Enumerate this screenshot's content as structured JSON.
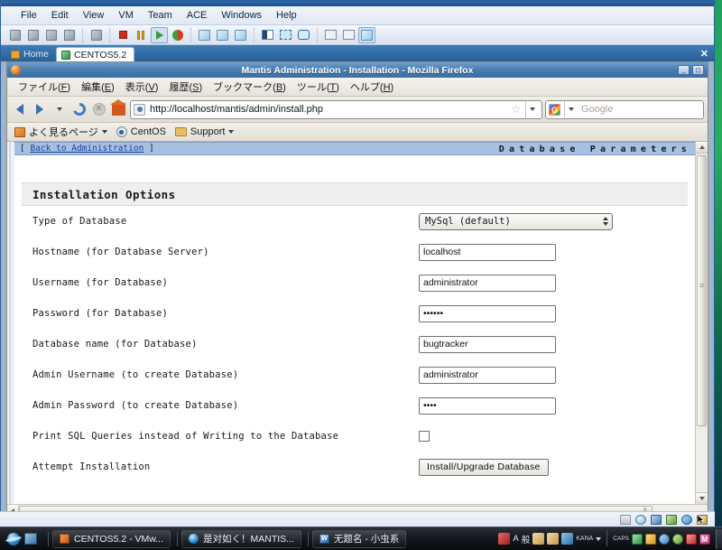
{
  "vmware": {
    "menu": [
      "File",
      "Edit",
      "View",
      "VM",
      "Team",
      "ACE",
      "Windows",
      "Help"
    ],
    "toolbar_icons": [
      "new-virtual-machine-icon",
      "new-team-icon",
      "power-on-this-vm-icon",
      "vm-settings-icon",
      "summary-view-icon",
      "power-off-icon",
      "suspend-icon",
      "power-on-icon",
      "reset-icon",
      "snapshot-icon",
      "revert-snapshot-icon",
      "snapshot-manager-icon",
      "show-sidebar-icon",
      "full-screen-icon",
      "quick-switch-icon",
      "unity-icon",
      "console-view-icon",
      "fit-guest-icon"
    ],
    "tabs": [
      {
        "label": "Home",
        "icon": "home-icon",
        "active": false
      },
      {
        "label": "CENTOS5.2",
        "icon": "virtual-machine-icon",
        "active": true
      }
    ],
    "tabs_close_label": "✕",
    "status_icons": [
      "hard-disk-icon",
      "cd-dvd-icon",
      "floppy-icon",
      "network-adapter-icon",
      "sound-card-icon",
      "usb-icon"
    ]
  },
  "firefox": {
    "title": "Mantis Administration - Installation - Mozilla Firefox",
    "window_buttons": {
      "minimize": "_",
      "maximize": "□"
    },
    "menu": [
      {
        "text": "ファイル(",
        "key": "F",
        "close": ")"
      },
      {
        "text": "編集(",
        "key": "E",
        "close": ")"
      },
      {
        "text": "表示(",
        "key": "V",
        "close": ")"
      },
      {
        "text": "履歴(",
        "key": "S",
        "close": ")"
      },
      {
        "text": "ブックマーク(",
        "key": "B",
        "close": ")"
      },
      {
        "text": "ツール(",
        "key": "T",
        "close": ")"
      },
      {
        "text": "ヘルプ(",
        "key": "H",
        "close": ")"
      }
    ],
    "nav": {
      "back_label": "戻る",
      "forward_label": "進む",
      "reload_label": "再読み込み",
      "stop_label": "中止",
      "home_label": "ホーム"
    },
    "url": "http://localhost/mantis/admin/install.php",
    "search_placeholder": "Google",
    "bookmarks": [
      {
        "label": "よく見るページ",
        "icon": "most-visited-icon",
        "has_caret": true
      },
      {
        "label": "CentOS",
        "icon": "centos-icon",
        "has_caret": false
      },
      {
        "label": "Support",
        "icon": "folder-icon",
        "has_caret": true
      }
    ]
  },
  "page": {
    "back_link_open": "[",
    "back_link": "Back to Administration",
    "back_link_close": "]",
    "header_title": "Database Parameters",
    "section_title": "Installation Options",
    "rows": [
      {
        "label": "Type of Database",
        "type": "select",
        "value": "MySql (default)",
        "name": "type-of-database-select"
      },
      {
        "label": "Hostname (for Database Server)",
        "type": "text",
        "value": "localhost",
        "name": "hostname-input"
      },
      {
        "label": "Username (for Database)",
        "type": "text",
        "value": "administrator",
        "name": "db-username-input"
      },
      {
        "label": "Password (for Database)",
        "type": "password",
        "value": "••••••",
        "name": "db-password-input"
      },
      {
        "label": "Database name (for Database)",
        "type": "text",
        "value": "bugtracker",
        "name": "database-name-input"
      },
      {
        "label": "Admin Username (to create Database)",
        "type": "text",
        "value": "administrator",
        "name": "admin-username-input"
      },
      {
        "label": "Admin Password (to create Database)",
        "type": "password",
        "value": "••••",
        "name": "admin-password-input"
      },
      {
        "label": "Print SQL Queries instead of Writing to the Database",
        "type": "checkbox",
        "value": "",
        "name": "print-sql-queries-checkbox"
      },
      {
        "label": "Attempt Installation",
        "type": "button",
        "value": "Install/Upgrade Database",
        "name": "install-upgrade-database-button"
      }
    ]
  },
  "taskbar": {
    "quick_launch": [
      "internet-explorer-icon",
      "show-desktop-icon"
    ],
    "items": [
      {
        "label": "CENTOS5.2 - VMw...",
        "icon": "vmware-icon"
      },
      {
        "label": "是对如く！MANTIS...",
        "icon": "internet-explorer-icon"
      },
      {
        "label": "无题名 - 小虫系",
        "icon": "word-icon"
      }
    ],
    "ime": {
      "mode_a": "A",
      "mode_b": "般",
      "kana": "KANA"
    },
    "caps": "CAPS",
    "tray_icons": [
      "safely-remove-hardware-icon",
      "volume-icon",
      "network-icon",
      "antivirus-icon",
      "update-icon",
      "messenger-icon"
    ]
  }
}
